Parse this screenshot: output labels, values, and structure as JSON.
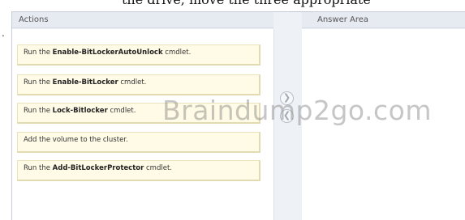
{
  "header_cutoff_text": "the drive, move the three appropriate",
  "left_bullet": ".",
  "panels": {
    "actions_title": "Actions",
    "answer_title": "Answer Area"
  },
  "actions": [
    {
      "prefix": "Run the ",
      "bold": "Enable-BitLockerAutoUnlock",
      "suffix": " cmdlet."
    },
    {
      "prefix": "Run the ",
      "bold": "Enable-BitLocker",
      "suffix": " cmdlet."
    },
    {
      "prefix": "Run the ",
      "bold": "Lock-Bitlocker",
      "suffix": " cmdlet."
    },
    {
      "prefix": "",
      "bold": "",
      "suffix": "Add the volume to the cluster."
    },
    {
      "prefix": "Run the ",
      "bold": "Add-BitLockerProtector",
      "suffix": " cmdlet."
    }
  ],
  "controls": {
    "move_right_icon": "chevron-right-icon",
    "move_left_icon": "chevron-left-icon",
    "move_right_glyph": "❯",
    "move_left_glyph": "❮"
  },
  "watermark": "Braindump2go.com",
  "colors": {
    "item_background": "#fffbe6",
    "item_border": "#e9e2bb",
    "frame_background": "#eef1f5"
  }
}
